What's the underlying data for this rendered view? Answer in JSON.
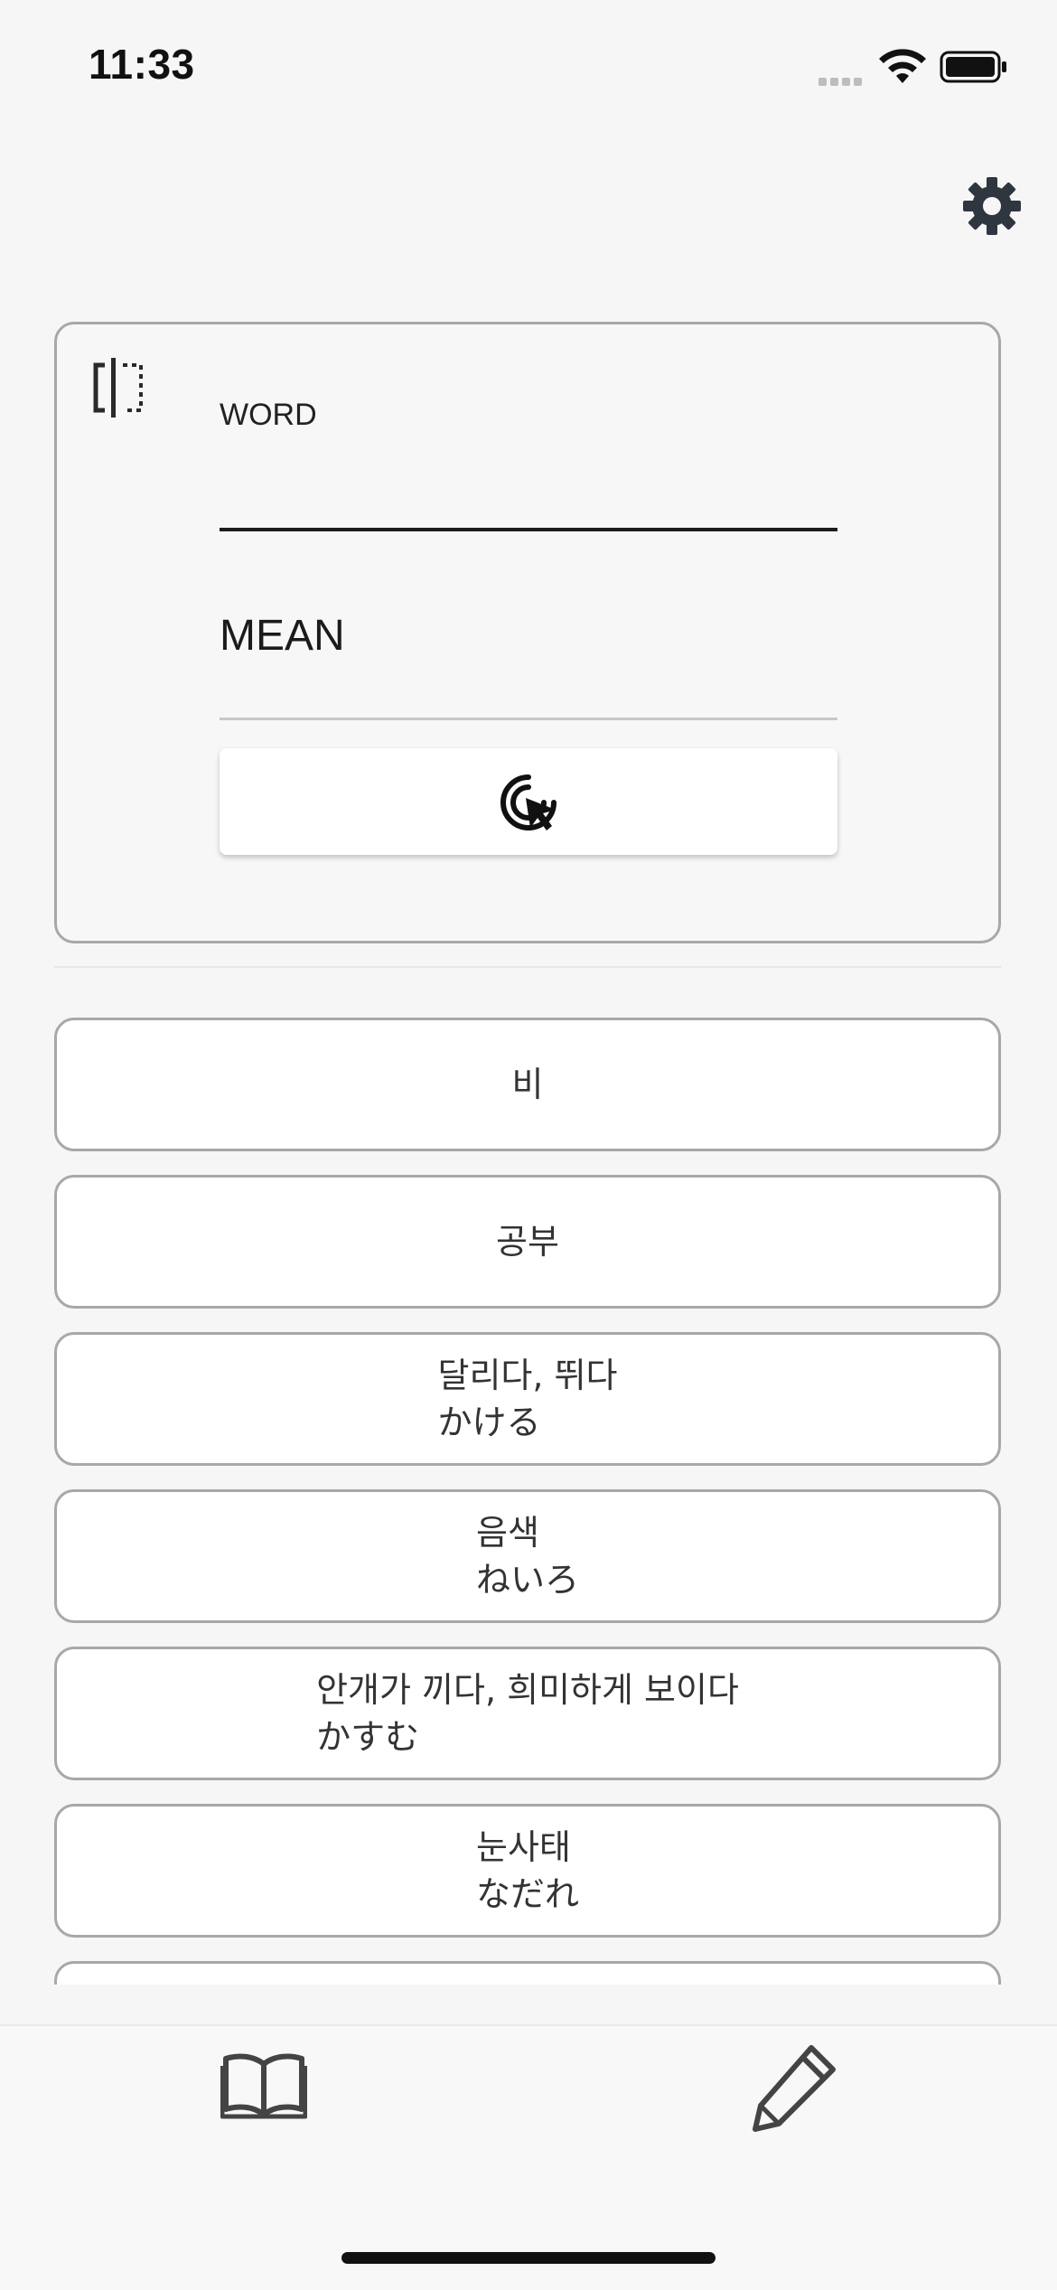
{
  "status_bar": {
    "time": "11:33"
  },
  "editor": {
    "word_label": "WORD",
    "word_value": "",
    "mean_label": "MEAN",
    "mean_value": ""
  },
  "word_list": [
    {
      "lines": [
        "비"
      ]
    },
    {
      "lines": [
        "공부"
      ]
    },
    {
      "lines": [
        "달리다, 뛰다",
        "かける"
      ]
    },
    {
      "lines": [
        "음색",
        "ねいろ"
      ]
    },
    {
      "lines": [
        "안개가 끼다, 희미하게 보이다",
        "かすむ"
      ]
    },
    {
      "lines": [
        "눈사태",
        "なだれ"
      ]
    },
    {
      "lines": [
        ""
      ]
    }
  ],
  "icons": {
    "settings": "gear-icon",
    "split": "split-view-icon",
    "tap": "tap-cursor-icon",
    "tab_1": "book-icon",
    "tab_2": "pencil-icon"
  },
  "colors": {
    "background": "#f6f6f6",
    "card_border": "#a8a8a8",
    "icon": "#2f3640",
    "text": "#333333"
  }
}
